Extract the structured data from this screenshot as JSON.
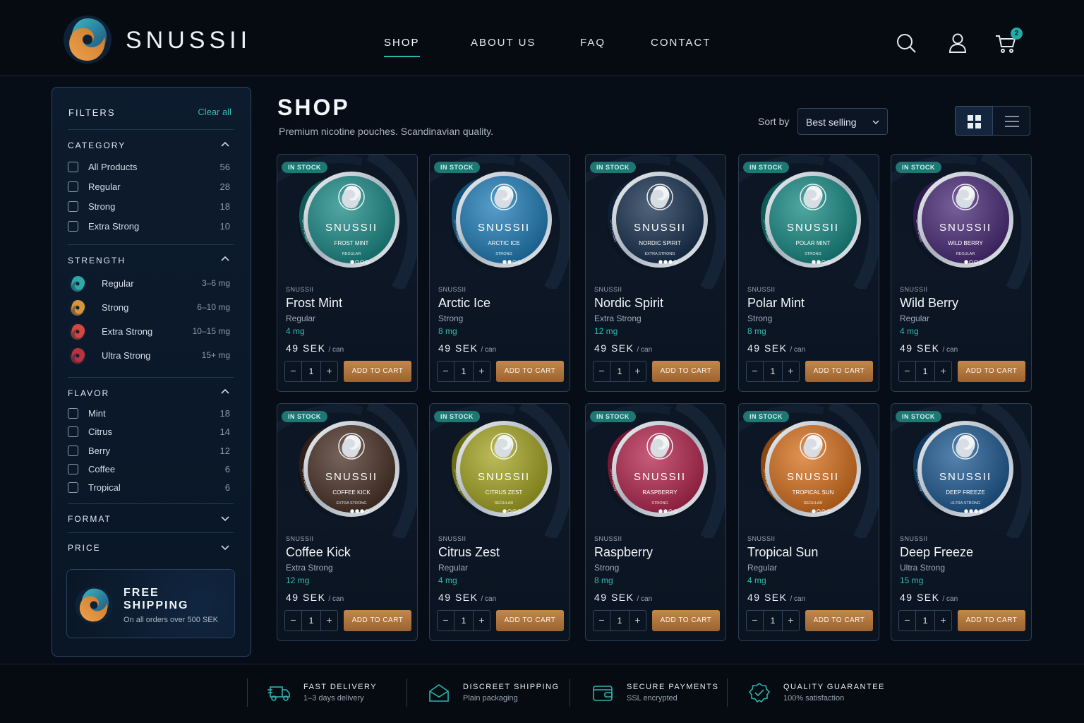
{
  "header": {
    "brand": "SNUSSII",
    "nav": [
      "SHOP",
      "ABOUT US",
      "FAQ",
      "CONTACT"
    ],
    "active_nav": "SHOP",
    "cart_count": "2",
    "icons": [
      "search-icon",
      "user-icon",
      "cart-icon"
    ]
  },
  "colors": {
    "accent": "#2bb5ae",
    "button": "#b07840",
    "background": "#070d16"
  },
  "sidebar": {
    "title": "FILTERS",
    "clear": "Clear all",
    "category": {
      "title": "CATEGORY",
      "items": [
        {
          "label": "All Products",
          "count": "56"
        },
        {
          "label": "Regular",
          "count": "28"
        },
        {
          "label": "Strong",
          "count": "18"
        },
        {
          "label": "Extra Strong",
          "count": "10"
        }
      ]
    },
    "strength": {
      "title": "STRENGTH",
      "items": [
        {
          "label": "Regular",
          "range": "3–6 mg",
          "color": "#2fa7a8"
        },
        {
          "label": "Strong",
          "range": "6–10 mg",
          "color": "#d7953b"
        },
        {
          "label": "Extra Strong",
          "range": "10–15 mg",
          "color": "#d2473e"
        },
        {
          "label": "Ultra Strong",
          "range": "15+ mg",
          "color": "#b8323f"
        }
      ]
    },
    "flavor": {
      "title": "FLAVOR",
      "items": [
        {
          "label": "Mint",
          "count": "18"
        },
        {
          "label": "Citrus",
          "count": "14"
        },
        {
          "label": "Berry",
          "count": "12"
        },
        {
          "label": "Coffee",
          "count": "6"
        },
        {
          "label": "Tropical",
          "count": "6"
        }
      ]
    },
    "format": {
      "title": "FORMAT"
    },
    "price": {
      "title": "PRICE"
    },
    "shipping": {
      "title": "FREE SHIPPING",
      "subtitle": "On all orders over 500 SEK"
    }
  },
  "main": {
    "title": "SHOP",
    "subtitle": "Premium nicotine pouches. Scandinavian quality.",
    "sort_label": "Sort by",
    "sort_value": "Best selling"
  },
  "product_common": {
    "stock": "IN STOCK",
    "price": "49 SEK",
    "unit": "/ can",
    "add": "ADD TO CART",
    "qty": "1",
    "can_brand": "SNUSSII"
  },
  "products": [
    {
      "brand": "SNUSSII",
      "name": "Frost Mint",
      "can_name": "FROST MINT",
      "strength": "Regular",
      "can_strength": "REGULAR",
      "mg": "4 mg",
      "color": "#1a8a86",
      "dots": 1
    },
    {
      "brand": "SNUSSII",
      "name": "Arctic Ice",
      "can_name": "ARCTIC ICE",
      "strength": "Strong",
      "can_strength": "STRONG",
      "mg": "8 mg",
      "color": "#1f7db8",
      "dots": 2
    },
    {
      "brand": "SNUSSII",
      "name": "Nordic Spirit",
      "can_name": "NORDIC SPIRIT",
      "strength": "Extra Strong",
      "can_strength": "EXTRA STRONG",
      "mg": "12 mg",
      "color": "#16304f",
      "dots": 3
    },
    {
      "brand": "SNUSSII",
      "name": "Polar Mint",
      "can_name": "POLAR MINT",
      "strength": "Strong",
      "can_strength": "STRONG",
      "mg": "8 mg",
      "color": "#168a84",
      "dots": 2
    },
    {
      "brand": "SNUSSII",
      "name": "Wild Berry",
      "can_name": "WILD BERRY",
      "strength": "Regular",
      "can_strength": "REGULAR",
      "mg": "4 mg",
      "color": "#4a2a78",
      "dots": 1
    },
    {
      "brand": "SNUSSII",
      "name": "Coffee Kick",
      "can_name": "COFFEE KICK",
      "strength": "Extra Strong",
      "can_strength": "EXTRA STRONG",
      "mg": "12 mg",
      "color": "#4a3126",
      "dots": 3
    },
    {
      "brand": "SNUSSII",
      "name": "Citrus Zest",
      "can_name": "CITRUS ZEST",
      "strength": "Regular",
      "can_strength": "REGULAR",
      "mg": "4 mg",
      "color": "#a5a622",
      "dots": 1
    },
    {
      "brand": "SNUSSII",
      "name": "Raspberry",
      "can_name": "RASPBERRY",
      "strength": "Strong",
      "can_strength": "STRONG",
      "mg": "8 mg",
      "color": "#b5264f",
      "dots": 2
    },
    {
      "brand": "SNUSSII",
      "name": "Tropical Sun",
      "can_name": "TROPICAL SUN",
      "strength": "Regular",
      "can_strength": "REGULAR",
      "mg": "4 mg",
      "color": "#d8701d",
      "dots": 1
    },
    {
      "brand": "SNUSSII",
      "name": "Deep Freeze",
      "can_name": "DEEP FREEZE",
      "strength": "Ultra Strong",
      "can_strength": "ULTRA STRONG",
      "mg": "15 mg",
      "color": "#1d5a93",
      "dots": 4
    }
  ],
  "footer": [
    {
      "title": "FAST DELIVERY",
      "subtitle": "1–3 days delivery",
      "icon": "truck-icon"
    },
    {
      "title": "DISCREET SHIPPING",
      "subtitle": "Plain packaging",
      "icon": "envelope-icon"
    },
    {
      "title": "SECURE PAYMENTS",
      "subtitle": "SSL encrypted",
      "icon": "wallet-icon"
    },
    {
      "title": "QUALITY GUARANTEE",
      "subtitle": "100% satisfaction",
      "icon": "badge-check-icon"
    }
  ]
}
